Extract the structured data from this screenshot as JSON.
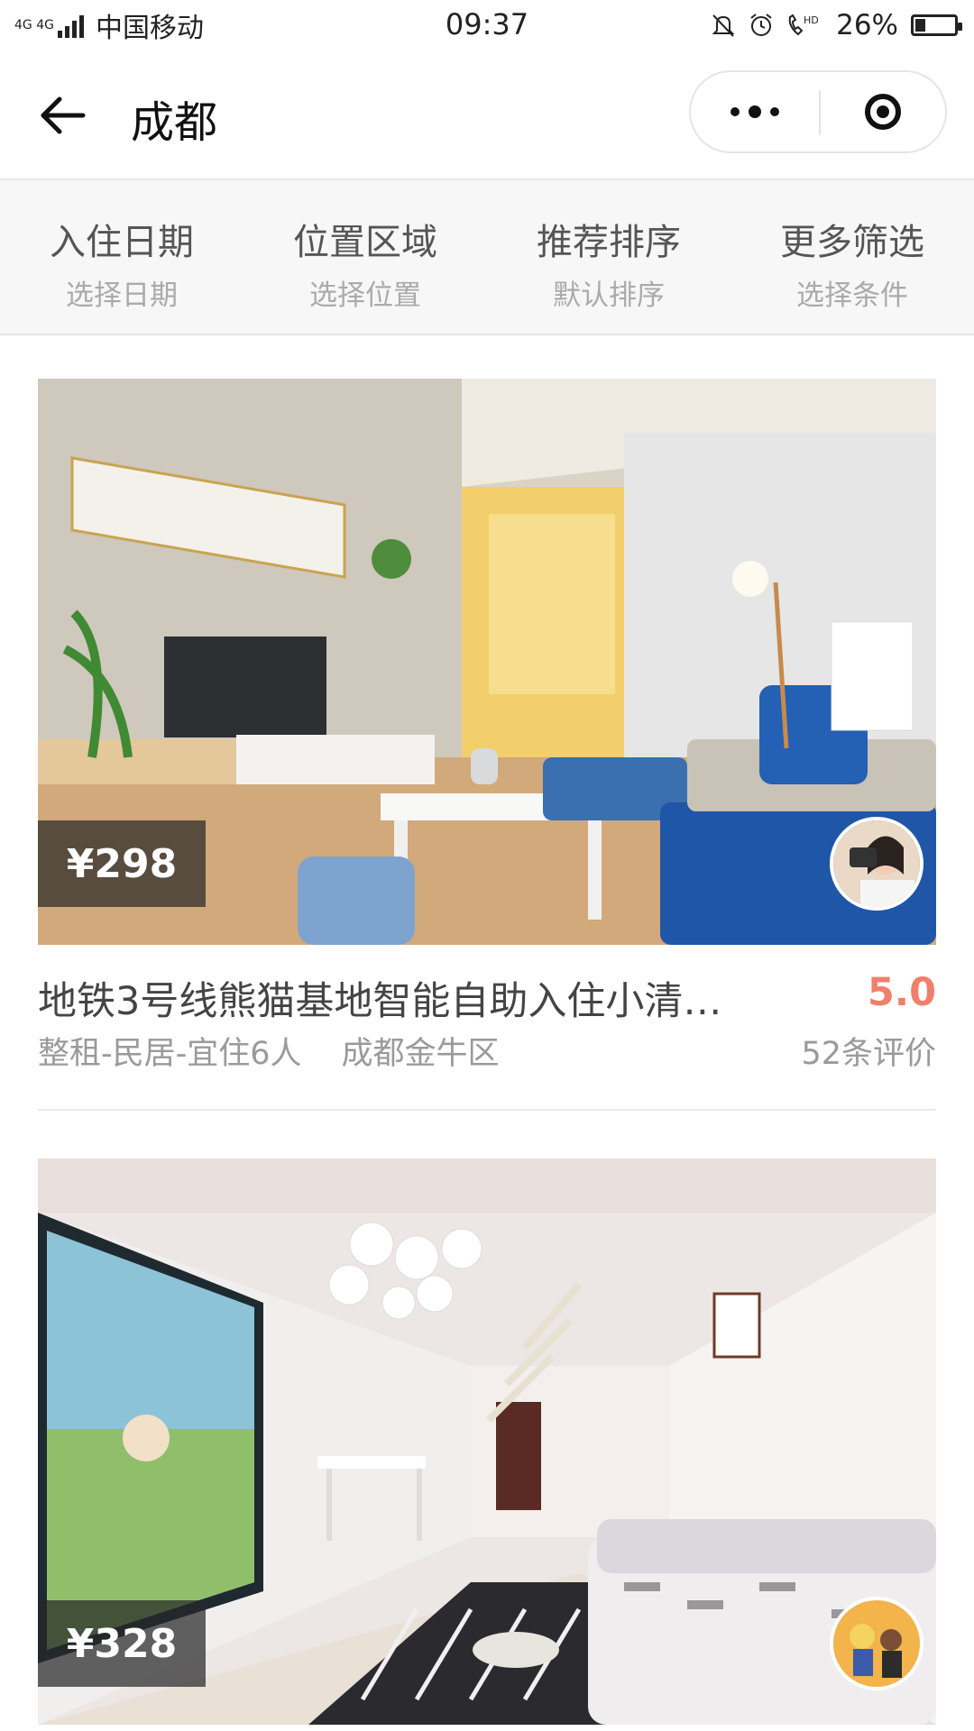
{
  "status_bar": {
    "network": "4G 4G",
    "carrier": "中国移动",
    "time": "09:37",
    "battery_percent": "26%",
    "battery_level": 0.26,
    "icons": [
      "bell-off-icon",
      "alarm-icon",
      "hd-call-icon"
    ]
  },
  "header": {
    "title": "成都",
    "back_icon": "arrow-left-icon",
    "more_icon": "more-dots-icon",
    "close_icon": "mini-program-close-icon"
  },
  "filters": [
    {
      "title": "入住日期",
      "sub": "选择日期"
    },
    {
      "title": "位置区域",
      "sub": "选择位置"
    },
    {
      "title": "推荐排序",
      "sub": "默认排序"
    },
    {
      "title": "更多筛选",
      "sub": "选择条件"
    }
  ],
  "listings": [
    {
      "price": "¥298",
      "title": "地铁3号线熊猫基地智能自助入住小清…",
      "rating": "5.0",
      "meta_type": "整租-民居-宜住6人",
      "meta_area": "成都金牛区",
      "reviews": "52条评价"
    },
    {
      "price": "¥328"
    }
  ],
  "colors": {
    "rating": "#f07f6b",
    "filter_bg": "#f7f7f7",
    "text_secondary": "#9a9a9a"
  }
}
